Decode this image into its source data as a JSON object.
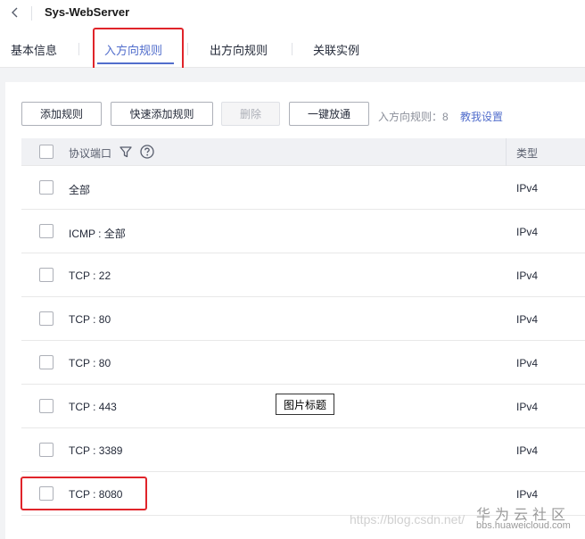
{
  "header": {
    "title": "Sys-WebServer"
  },
  "tabs": [
    {
      "label": "基本信息",
      "active": false
    },
    {
      "label": "入方向规则",
      "active": true
    },
    {
      "label": "出方向规则",
      "active": false
    },
    {
      "label": "关联实例",
      "active": false
    }
  ],
  "toolbar": {
    "add_rule": "添加规则",
    "quick_add_rule": "快速添加规则",
    "delete": "删除",
    "allow_all": "一键放通",
    "rule_count_label": "入方向规则：",
    "rule_count_value": "8",
    "help_link": "教我设置"
  },
  "table": {
    "columns": {
      "port": "协议端口",
      "type": "类型"
    },
    "rows": [
      {
        "port": "全部",
        "type": "IPv4"
      },
      {
        "port": "ICMP : 全部",
        "type": "IPv4"
      },
      {
        "port": "TCP : 22",
        "type": "IPv4"
      },
      {
        "port": "TCP : 80",
        "type": "IPv4"
      },
      {
        "port": "TCP : 80",
        "type": "IPv4"
      },
      {
        "port": "TCP : 443",
        "type": "IPv4"
      },
      {
        "port": "TCP : 3389",
        "type": "IPv4"
      },
      {
        "port": "TCP : 8080",
        "type": "IPv4"
      }
    ]
  },
  "tooltip": "图片标题",
  "watermark": {
    "csdn": "https://blog.csdn.net/",
    "brand": "华为云社区",
    "brand_url": "bbs.huaweicloud.com"
  },
  "colors": {
    "accent": "#526ecc",
    "highlight": "#e0242a",
    "header_bg": "#f0f1f4"
  },
  "icons": {
    "back": "chevron-left-icon",
    "filter": "filter-icon",
    "help": "question-circle-icon"
  }
}
